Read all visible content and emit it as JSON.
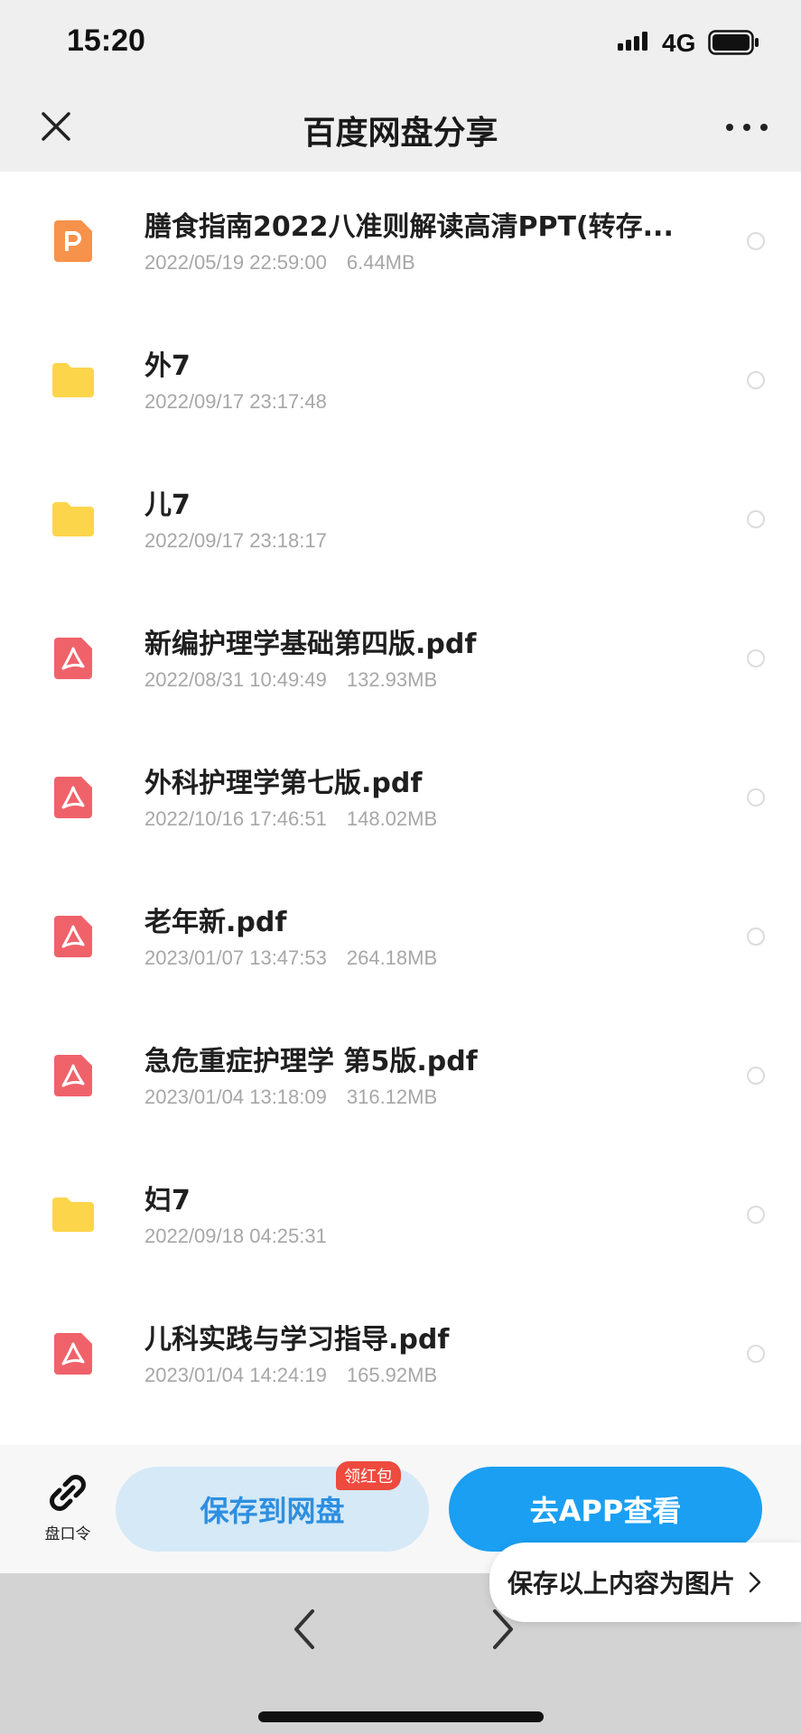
{
  "status_bar": {
    "time": "15:20",
    "network": "4G"
  },
  "nav": {
    "title": "百度网盘分享"
  },
  "files": [
    {
      "name": "膳食指南2022八准则解读高清PPT(转存...",
      "date": "2022/05/19 22:59:00",
      "size": "6.44MB",
      "type": "ppt"
    },
    {
      "name": "外7",
      "date": "2022/09/17 23:17:48",
      "size": "",
      "type": "folder"
    },
    {
      "name": "儿7",
      "date": "2022/09/17 23:18:17",
      "size": "",
      "type": "folder"
    },
    {
      "name": "新编护理学基础第四版.pdf",
      "date": "2022/08/31 10:49:49",
      "size": "132.93MB",
      "type": "pdf"
    },
    {
      "name": "外科护理学第七版.pdf",
      "date": "2022/10/16 17:46:51",
      "size": "148.02MB",
      "type": "pdf"
    },
    {
      "name": "老年新.pdf",
      "date": "2023/01/07 13:47:53",
      "size": "264.18MB",
      "type": "pdf"
    },
    {
      "name": "急危重症护理学 第5版.pdf",
      "date": "2023/01/04 13:18:09",
      "size": "316.12MB",
      "type": "pdf"
    },
    {
      "name": "妇7",
      "date": "2022/09/18 04:25:31",
      "size": "",
      "type": "folder"
    },
    {
      "name": "儿科实践与学习指导.pdf",
      "date": "2023/01/04 14:24:19",
      "size": "165.92MB",
      "type": "pdf"
    }
  ],
  "actions": {
    "link_code_label": "盘口令",
    "save_label": "保存到网盘",
    "save_badge": "领红包",
    "app_label": "去APP查看",
    "save_image_label": "保存以上内容为图片"
  },
  "colors": {
    "pdf": "#f0626a",
    "folder": "#fdd54a",
    "ppt": "#f7924a",
    "primary": "#1a9ff2"
  }
}
